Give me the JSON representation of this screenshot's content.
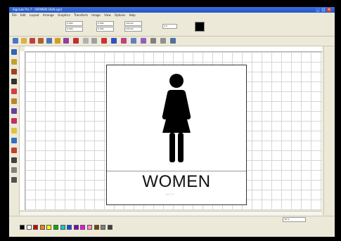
{
  "window": {
    "title": "SignLab Pro 7 - [WOMEN SIGN.sgn]"
  },
  "menu": [
    "File",
    "Edit",
    "Layout",
    "Arrange",
    "Graphics",
    "Transform",
    "Image",
    "View",
    "Options",
    "Help"
  ],
  "propbar": {
    "fields": [
      "0.000",
      "0.000",
      "0.000",
      "0.000",
      "100.00",
      "100.00",
      "0.0"
    ]
  },
  "sign": {
    "title": "WOMEN",
    "braille_text": "⠠⠺⠕⠍⠑⠝",
    "icon": "woman-restroom-icon"
  },
  "status": {
    "zoom": "38 %"
  },
  "palette": [
    "#000000",
    "#ffffff",
    "#d00000",
    "#ff7f00",
    "#ffff00",
    "#00b000",
    "#00cfcf",
    "#0050ff",
    "#8000c0",
    "#ff00ff",
    "#ff8fbf",
    "#804000",
    "#808080",
    "#404040"
  ],
  "icons": {
    "toolbox": [
      "select-icon",
      "shape-icon",
      "zoom-icon",
      "text-icon",
      "pen-icon",
      "fill-icon",
      "eraser-icon",
      "line-icon",
      "rectangle-icon",
      "ellipse-icon",
      "polygon-icon",
      "node-icon",
      "weld-icon",
      "contour-icon",
      "blend-icon",
      "knife-icon"
    ],
    "toolbar": [
      "new-icon",
      "open-icon",
      "save-icon",
      "print-icon",
      "cut-icon",
      "copy-icon",
      "paste-icon",
      "undo-icon",
      "redo-icon",
      "group-icon",
      "ungroup-icon",
      "align-icon",
      "grid-icon",
      "rotate-icon",
      "mirror-icon",
      "node-edit-icon",
      "measure-icon",
      "output-icon"
    ]
  }
}
